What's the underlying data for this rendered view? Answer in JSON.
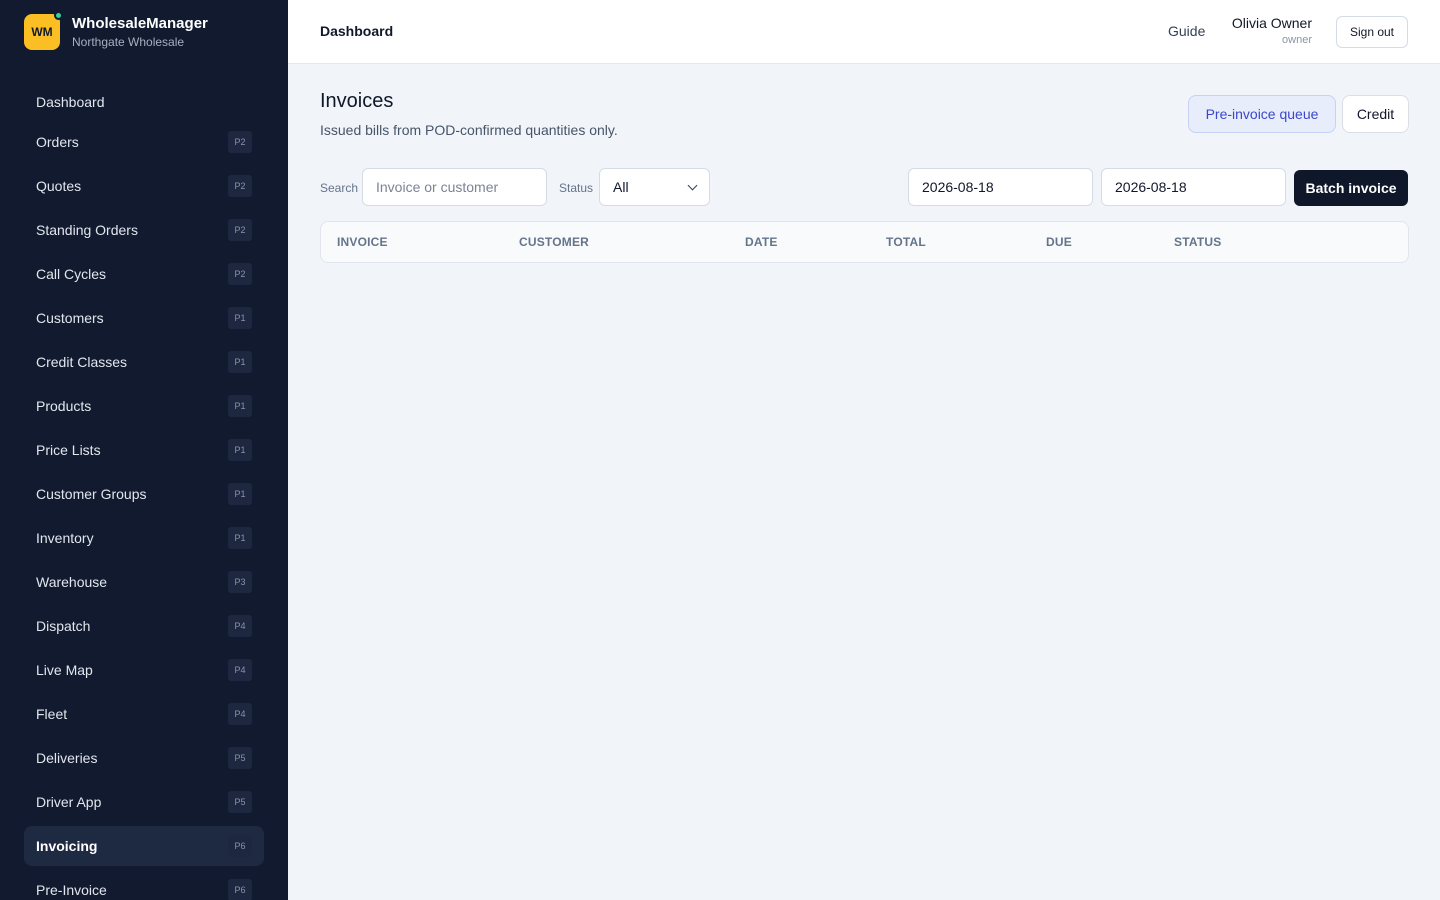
{
  "brand": {
    "logo": "WM",
    "name": "WholesaleManager",
    "company": "Northgate Wholesale"
  },
  "sidebar": {
    "items": [
      {
        "label": "Dashboard",
        "badge": ""
      },
      {
        "label": "Orders",
        "badge": "P2"
      },
      {
        "label": "Quotes",
        "badge": "P2"
      },
      {
        "label": "Standing Orders",
        "badge": "P2"
      },
      {
        "label": "Call Cycles",
        "badge": "P2"
      },
      {
        "label": "Customers",
        "badge": "P1"
      },
      {
        "label": "Credit Classes",
        "badge": "P1"
      },
      {
        "label": "Products",
        "badge": "P1"
      },
      {
        "label": "Price Lists",
        "badge": "P1"
      },
      {
        "label": "Customer Groups",
        "badge": "P1"
      },
      {
        "label": "Inventory",
        "badge": "P1"
      },
      {
        "label": "Warehouse",
        "badge": "P3"
      },
      {
        "label": "Dispatch",
        "badge": "P4"
      },
      {
        "label": "Live Map",
        "badge": "P4"
      },
      {
        "label": "Fleet",
        "badge": "P4"
      },
      {
        "label": "Deliveries",
        "badge": "P5"
      },
      {
        "label": "Driver App",
        "badge": "P5"
      },
      {
        "label": "Invoicing",
        "badge": "P6",
        "active": true
      },
      {
        "label": "Pre-Invoice",
        "badge": "P6"
      }
    ]
  },
  "header": {
    "breadcrumb": "Dashboard",
    "guide": "Guide",
    "user_name": "Olivia Owner",
    "user_role": "owner",
    "signout": "Sign out"
  },
  "main": {
    "title": "Invoices",
    "subtitle": "Issued bills from POD-confirmed quantities only.",
    "preinvoice_queue": "Pre-invoice queue",
    "credit": "Credit",
    "filters": {
      "search_label": "Search",
      "search_placeholder": "Invoice or customer",
      "status_label": "Status",
      "status_value": "All",
      "date_from": "2026-08-18",
      "date_to": "2026-08-18",
      "batch_invoice": "Batch invoice"
    },
    "table": {
      "columns": [
        "INVOICE",
        "CUSTOMER",
        "DATE",
        "TOTAL",
        "DUE",
        "STATUS"
      ],
      "rows": []
    }
  }
}
